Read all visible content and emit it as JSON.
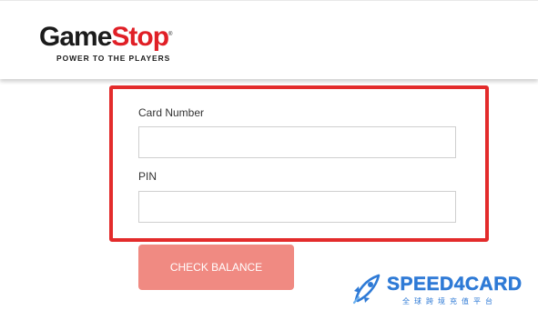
{
  "header": {
    "logo_game": "Game",
    "logo_stop": "Stop",
    "tagline": "POWER TO THE PLAYERS"
  },
  "form": {
    "card_number_label": "Card Number",
    "card_number_value": "",
    "pin_label": "PIN",
    "pin_value": "",
    "check_button_label": "CHECK BALANCE"
  },
  "watermark": {
    "name": "SPEED4CARD",
    "subtitle": "全球跨境充值平台",
    "icon": "rocket-icon"
  },
  "colors": {
    "highlight_border": "#e32b2b",
    "button_bg": "#f08a82",
    "brand_blue": "#2e7ad6",
    "logo_red": "#e01f26"
  }
}
